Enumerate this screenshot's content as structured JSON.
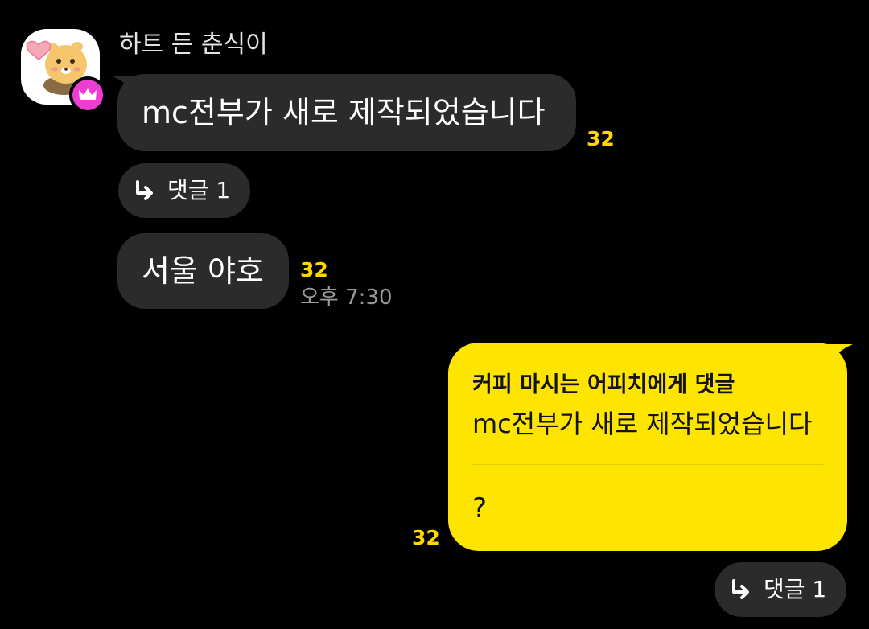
{
  "chat": {
    "sender_name": "하트 든 춘식이",
    "messages": [
      {
        "text": "mc전부가 새로 제작되었습니다",
        "unread_count": "32",
        "reply_chip": {
          "label": "댓글 1"
        }
      },
      {
        "text": "서울 야호",
        "unread_count": "32",
        "time": "오후 7:30"
      }
    ],
    "my_message": {
      "reply_to_label": "커피 마시는 어피치에게 댓글",
      "quoted_text": "mc전부가 새로 제작되었습니다",
      "text": "?",
      "unread_count": "32",
      "reply_chip": {
        "label": "댓글 1"
      }
    }
  },
  "colors": {
    "background": "#000000",
    "incoming_bubble": "#2b2b2b",
    "outgoing_bubble": "#fee500",
    "unread_count": "#ffd800",
    "crown_badge": "#ef3dd3"
  },
  "icons": {
    "avatar": "chunsik-character-avatar",
    "badge": "crown-icon",
    "reply": "reply-arrow-icon"
  }
}
